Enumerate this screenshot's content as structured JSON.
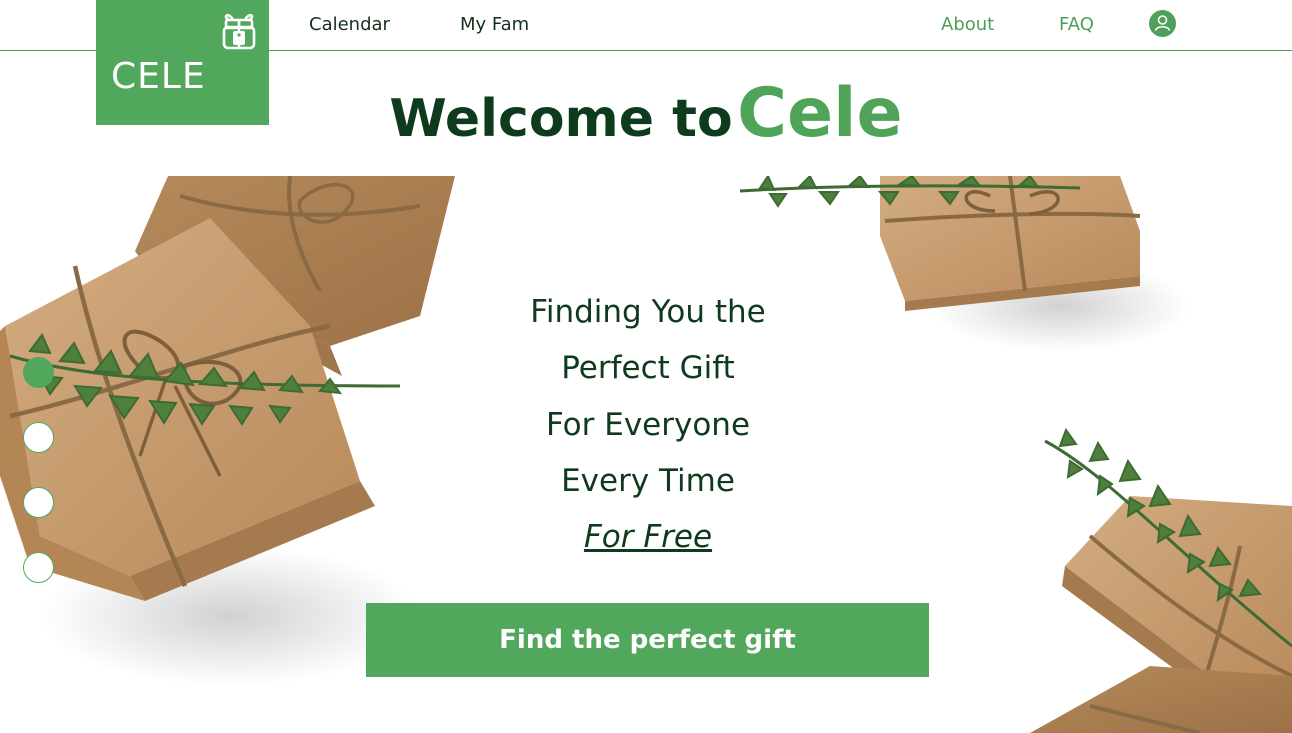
{
  "brand": {
    "name": "CELE",
    "color": "#51a85c",
    "icon": "gift-tag-icon"
  },
  "nav": {
    "calendar": "Calendar",
    "my_fam": "My Fam",
    "about": "About",
    "faq": "FAQ",
    "profile_icon": "user-icon"
  },
  "hero": {
    "welcome_prefix": "Welcome to",
    "welcome_brand": "Cele",
    "lines": [
      "Finding You the",
      "Perfect Gift",
      "For Everyone",
      "Every Time"
    ],
    "emphasis": "For Free",
    "cta_label": "Find the perfect gift"
  },
  "carousel": {
    "slides": 4,
    "active_index": 0
  },
  "colors": {
    "accent": "#51a85c",
    "dark_green": "#0e3a1d",
    "kraft": "#c49a6c",
    "twine": "#8a6a45"
  }
}
